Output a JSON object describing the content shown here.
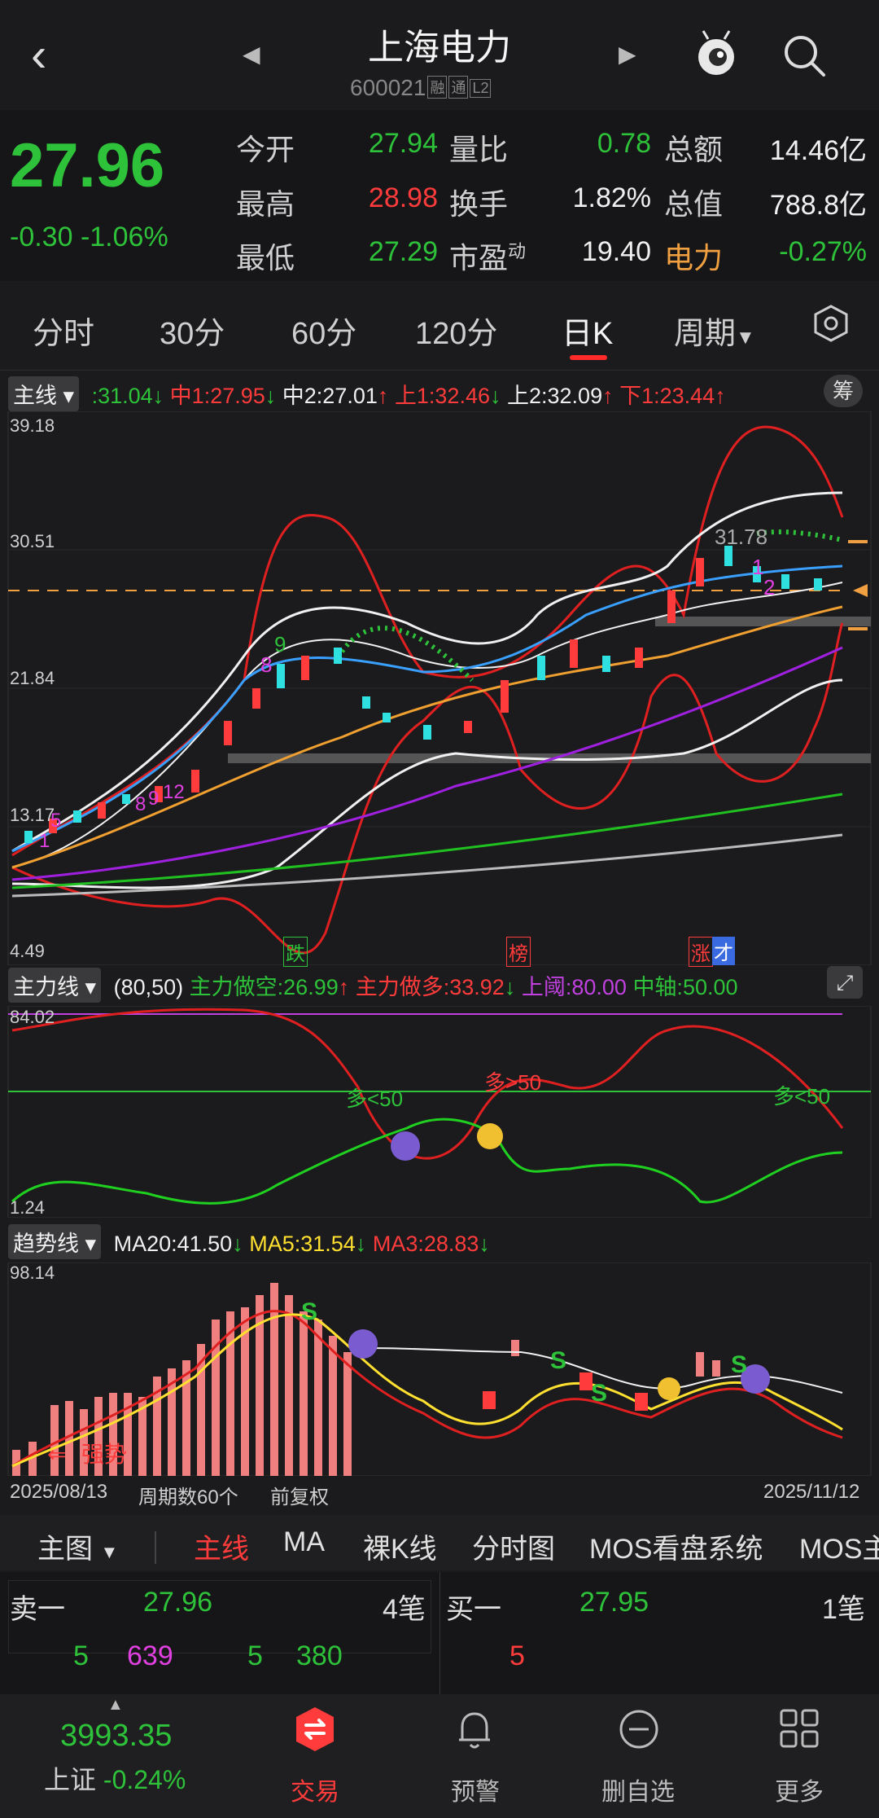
{
  "header": {
    "name": "上海电力",
    "code": "600021",
    "tags": [
      "融",
      "通",
      "L2"
    ]
  },
  "quote": {
    "price": "27.96",
    "change": "-0.30",
    "change_pct": "-1.06%",
    "fields": [
      {
        "label": "今开",
        "value": "27.94",
        "color": "green"
      },
      {
        "label": "量比",
        "value": "0.78",
        "color": "green"
      },
      {
        "label": "总额",
        "value": "14.46亿",
        "color": "white"
      },
      {
        "label": "最高",
        "value": "28.98",
        "color": "red"
      },
      {
        "label": "换手",
        "value": "1.82%",
        "color": "white"
      },
      {
        "label": "总值",
        "value": "788.8亿",
        "color": "white"
      },
      {
        "label": "最低",
        "value": "27.29",
        "color": "green"
      },
      {
        "label": "市盈",
        "label_sup": "动",
        "value": "19.40",
        "color": "white"
      },
      {
        "label": "电力",
        "value": "-0.27%",
        "color": "green",
        "label_color": "#f0a040"
      }
    ]
  },
  "tabs": [
    "分时",
    "30分",
    "60分",
    "120分",
    "日K",
    "周期"
  ],
  "main_indicator": {
    "name": "主线",
    "values": [
      {
        "text": ":31.04",
        "color": "#2ec23a",
        "arrow": "↓"
      },
      {
        "text": "中1:27.95",
        "color": "#ff3b3b",
        "arrow": "↓"
      },
      {
        "text": "中2:27.01",
        "color": "#f0f0f0",
        "arrow": "↑"
      },
      {
        "text": "上1:32.46",
        "color": "#ff3b3b",
        "arrow": "↓"
      },
      {
        "text": "上2:32.09",
        "color": "#f0f0f0",
        "arrow": "↑"
      },
      {
        "text": "下1:23.44",
        "color": "#ff3b3b",
        "arrow": "↑"
      }
    ],
    "chip_button": "筹",
    "y_labels": [
      "39.18",
      "30.51",
      "21.84",
      "13.17",
      "4.49"
    ],
    "peak_label": "31.78",
    "events": [
      "跌",
      "榜",
      "涨",
      "才"
    ],
    "counts": [
      "1",
      "5",
      "8",
      "9",
      "12",
      "8",
      "9",
      "1",
      "2"
    ]
  },
  "force_indicator": {
    "name": "主力线",
    "params": "(80,50)",
    "values": [
      {
        "text": "主力做空:26.99",
        "color": "#2ec23a",
        "arrow": "↑"
      },
      {
        "text": "主力做多:33.92",
        "color": "#ff3b3b",
        "arrow": "↓"
      },
      {
        "text": "上阈:80.00",
        "color": "#c040e0",
        "arrow": ""
      },
      {
        "text": "中轴:50.00",
        "color": "#2ec23a",
        "arrow": ""
      }
    ],
    "y_labels": [
      "84.02",
      "1.24"
    ],
    "annotations": [
      "多<50",
      "多>50",
      "多<50"
    ]
  },
  "trend_indicator": {
    "name": "趋势线",
    "values": [
      {
        "text": "MA20:41.50",
        "color": "#f0f0f0",
        "arrow": "↓"
      },
      {
        "text": "MA5:31.54",
        "color": "#ffe030",
        "arrow": "↓"
      },
      {
        "text": "MA3:28.83",
        "color": "#ff3b3b",
        "arrow": "↓"
      }
    ],
    "y_label": "98.14",
    "strong_label": "强势"
  },
  "footer_info": {
    "start_date": "2025/08/13",
    "period_count": "周期数60个",
    "adjust": "前复权",
    "end_date": "2025/11/12"
  },
  "indicator_tabs": {
    "main_chart": "主图",
    "items": [
      "主线",
      "MA",
      "裸K线",
      "分时图",
      "MOS看盘系统",
      "MOS主"
    ]
  },
  "orderbook": {
    "sell1_label": "卖一",
    "sell1_price": "27.96",
    "sell1_count": "4笔",
    "buy1_label": "买一",
    "buy1_price": "27.95",
    "buy1_count": "1笔",
    "sell_detail": [
      "5",
      "639",
      "5",
      "380"
    ],
    "buy_detail": [
      "5"
    ]
  },
  "bottom_nav": {
    "index_value": "3993.35",
    "index_name": "上证",
    "index_change": "-0.24%",
    "items": [
      "交易",
      "预警",
      "删自选",
      "更多"
    ]
  },
  "colors": {
    "up": "#ff3b3b",
    "down": "#2ec23a",
    "background": "#1b1b1d"
  }
}
